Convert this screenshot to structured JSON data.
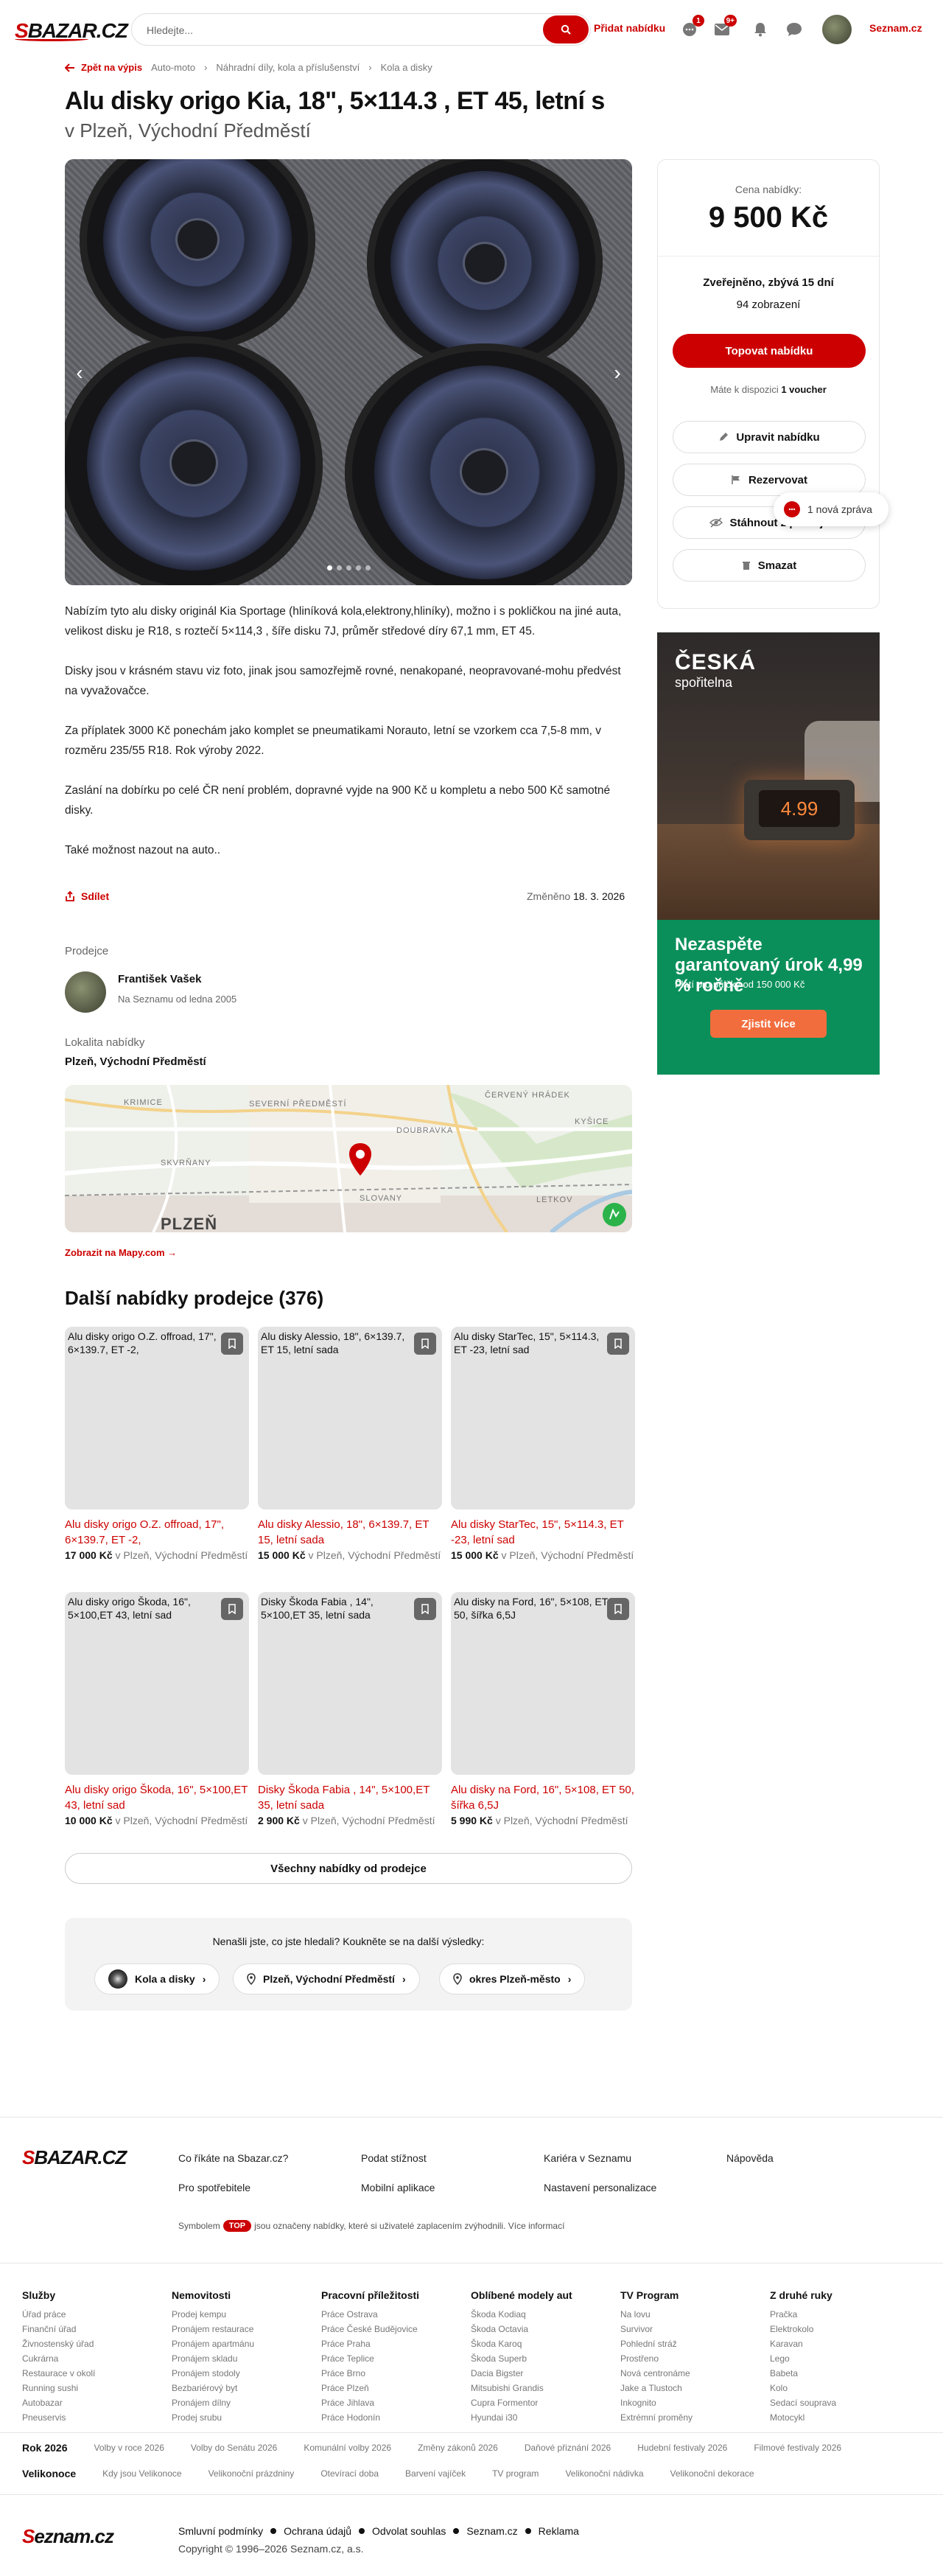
{
  "header": {
    "logo_a": "S",
    "logo_b": "BAZAR",
    "logo_c": ".CZ",
    "search_placeholder": "Hledejte...",
    "add_label": "Přidat nabídku",
    "badge_dots": "1",
    "badge_mail": "9+",
    "seznam_label": "Seznam.cz"
  },
  "breadcrumb": [
    "Zpět na výpis",
    "Auto-moto",
    "Náhradní díly, kola a příslušenství",
    "Kola a disky"
  ],
  "listing": {
    "title": "Alu disky origo Kia, 18\", 5×114.3 , ET 45, letní s",
    "location": "v Plzeň, Východní Předměstí",
    "description": [
      "Nabízím tyto alu disky originál Kia Sportage (hliníková kola,elektrony,hliníky), možno i s pokličkou na jiné auta, velikost disku je R18, s roztečí 5×114,3 , šíře disku 7J, průměr středové díry 67,1 mm, ET 45.",
      "Disky jsou v krásném stavu viz foto, jinak jsou samozřejmě rovné, nenakopané, neopravované-mohu předvést na vyvažovačce.",
      "Za příplatek 3000 Kč ponechám jako komplet se pneumatikami Norauto, letní se vzorkem cca 7,5-8 mm, v rozměru 235/55 R18. Rok výroby 2022.",
      "Zaslání na dobírku po celé ČR není problém, dopravné vyjde na 900 Kč u kompletu a nebo 500 Kč samotné disky.",
      "Také možnost nazout na auto.."
    ],
    "share_label": "Sdílet",
    "changed_label": "Změněno",
    "changed_date": "18. 3. 2026",
    "gallery_count": 5,
    "gallery_active": 0
  },
  "seller": {
    "heading": "Prodejce",
    "name": "František Vašek",
    "since": "Na Seznamu od ledna 2005"
  },
  "locality": {
    "heading": "Lokalita nabídky",
    "value": "Plzeň, Východní Předměstí",
    "map_link": "Zobrazit na Mapy.com →",
    "map_labels": [
      "KRIMICE",
      "SEVERNÍ PŘEDMĚSTÍ",
      "ČERVENÝ HRÁDEK",
      "KYŠICE",
      "DOUBRAVKA",
      "SKVRŇANY",
      "SLOVANY",
      "LETKOV",
      "PLZEŇ"
    ]
  },
  "more": {
    "heading": "Další nabídky prodejce (376)",
    "items": [
      {
        "title": "Alu disky origo O.Z. offroad, 17\", 6×139.7, ET -2,",
        "price": "17 000 Kč",
        "loc": "v Plzeň, Východní Předměstí"
      },
      {
        "title": "Alu disky Alessio, 18\", 6×139.7, ET 15, letní sada",
        "price": "15 000 Kč",
        "loc": "v Plzeň, Východní Předměstí"
      },
      {
        "title": "Alu disky StarTec, 15\", 5×114.3, ET -23, letní sad",
        "price": "15 000 Kč",
        "loc": "v Plzeň, Východní Předměstí"
      },
      {
        "title": "Alu disky origo Škoda, 16\", 5×100,ET 43, letní sad",
        "price": "10 000 Kč",
        "loc": "v Plzeň, Východní Předměstí"
      },
      {
        "title": "Disky Škoda Fabia , 14\", 5×100,ET 35, letní sada",
        "price": "2 900 Kč",
        "loc": "v Plzeň, Východní Předměstí"
      },
      {
        "title": "Alu disky na Ford, 16\", 5×108, ET 50, šířka 6,5J",
        "price": "5 990 Kč",
        "loc": "v Plzeň, Východní Předměstí"
      }
    ],
    "all_label": "Všechny nabídky od prodejce"
  },
  "notfound": {
    "question": "Nenašli jste, co jste hledali? Koukněte se na další výsledky:",
    "chips": [
      "Kola a disky",
      "Plzeň, Východní Předměstí",
      "okres Plzeň-město"
    ]
  },
  "sidebar": {
    "price_label": "Cena nabídky:",
    "price_value": "9 500 Kč",
    "published": "Zveřejněno, zbývá 15 dní",
    "views": "94 zobrazení",
    "top_label": "Topovat nabídku",
    "voucher_pre": "Máte k dispozici",
    "voucher_val": "1 voucher",
    "edit_label": "Upravit nabídku",
    "reserve_label": "Rezervovat",
    "withdraw_label": "Stáhnout z prodeje",
    "delete_label": "Smazat",
    "message_pill": "1 nová zpráva"
  },
  "ad": {
    "brand_a": "ČESKÁ",
    "brand_b": "spořitelna",
    "clock": "4.99",
    "headline": "Nezaspěte garantovaný úrok 4,99 % ročně",
    "sub": "Platí pro půjčky od 150 000 Kč",
    "cta": "Zjistit více"
  },
  "footer": {
    "links": [
      "Co říkáte na Sbazar.cz?",
      "Podat stížnost",
      "Kariéra v Seznamu",
      "Nápověda",
      "Pro spotřebitele",
      "Mobilní aplikace",
      "Nastavení personalizace"
    ],
    "top_note_pre": "Symbolem",
    "top_badge": "TOP",
    "top_note_post": "jsou označeny nabídky, které si uživatelé zaplacením zvýhodnili. Více informací",
    "columns": [
      {
        "title": "Služby",
        "items": [
          "Úřad práce",
          "Finanční úřad",
          "Živnostenský úřad",
          "Cukrárna",
          "Restaurace v okolí",
          "Running sushi",
          "Autobazar",
          "Pneuservis"
        ]
      },
      {
        "title": "Nemovitosti",
        "items": [
          "Prodej kempu",
          "Pronájem restaurace",
          "Pronájem apartmánu",
          "Pronájem skladu",
          "Pronájem stodoly",
          "Bezbariérový byt",
          "Pronájem dílny",
          "Prodej srubu"
        ]
      },
      {
        "title": "Pracovní příležitosti",
        "items": [
          "Práce Ostrava",
          "Práce České Budějovice",
          "Práce Praha",
          "Práce Teplice",
          "Práce Brno",
          "Práce Plzeň",
          "Práce Jihlava",
          "Práce Hodonín"
        ]
      },
      {
        "title": "Oblíbené modely aut",
        "items": [
          "Škoda Kodiaq",
          "Škoda Octavia",
          "Škoda Karoq",
          "Škoda Superb",
          "Dacia Bigster",
          "Mitsubishi Grandis",
          "Cupra Formentor",
          "Hyundai i30"
        ]
      },
      {
        "title": "TV Program",
        "items": [
          "Na lovu",
          "Survivor",
          "Pohlední stráž",
          "Prostřeno",
          "Nová centronáme",
          "Jake a Tlustoch",
          "Inkognito",
          "Extrémní proměny"
        ]
      },
      {
        "title": "Z druhé ruky",
        "items": [
          "Pračka",
          "Elektrokolo",
          "Karavan",
          "Lego",
          "Babeta",
          "Kolo",
          "Sedací souprava",
          "Motocykl"
        ]
      }
    ],
    "year_title": "Rok 2026",
    "year_items": [
      "Volby v roce 2026",
      "Volby do Senátu 2026",
      "Komunální volby 2026",
      "Změny zákonů 2026",
      "Daňové přiznání 2026",
      "Hudební festivaly 2026",
      "Filmové festivaly 2026"
    ],
    "easter_title": "Velikonoce",
    "easter_items": [
      "Kdy jsou Velikonoce",
      "Velikonoční prázdniny",
      "Otevírací doba",
      "Barvení vajíček",
      "TV program",
      "Velikonoční nádivka",
      "Velikonoční dekorace"
    ],
    "seznam_logo_a": "S",
    "seznam_logo_b": "eznam.cz",
    "legal": [
      "Smluvní podmínky",
      "Ochrana údajů",
      "Odvolat souhlas",
      "Seznam.cz",
      "Reklama"
    ],
    "copyright": "Copyright © 1996–2026 Seznam.cz, a.s."
  },
  "colors": {
    "brand_red": "#cc0000",
    "ad_green": "#0a8f5a",
    "ad_orange": "#f26d3d"
  }
}
